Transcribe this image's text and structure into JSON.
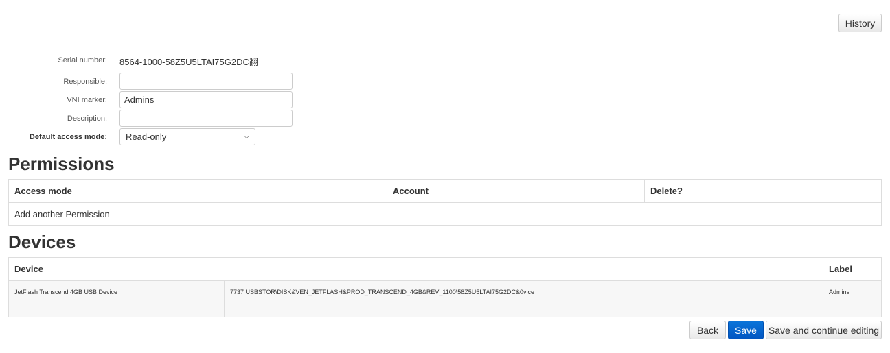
{
  "history_label": "History",
  "form": {
    "serial_label": "Serial number:",
    "serial_value": "8564-1000-58Z5U5LTAI75G2DC翻",
    "responsible_label": "Responsible:",
    "responsible_value": "",
    "vni_label": "VNI marker:",
    "vni_value": "Admins",
    "description_label": "Description:",
    "description_value": "",
    "access_label": "Default access mode:",
    "access_value": "Read-only"
  },
  "permissions": {
    "title": "Permissions",
    "headers": [
      "Access mode",
      "Account",
      "Delete?"
    ],
    "add_label": "Add another Permission"
  },
  "devices": {
    "title": "Devices",
    "headers": [
      "Device",
      "Label"
    ],
    "rows": [
      {
        "name": "JetFlash Transcend 4GB USB Device",
        "id": "7737 USBSTOR\\DISK&VEN_JETFLASH&PROD_TRANSCEND_4GB&REV_1100\\58Z5U5LTAI75G2DC&0vice",
        "label": "Admins"
      }
    ]
  },
  "footer": {
    "back": "Back",
    "save": "Save",
    "save_continue": "Save and continue editing"
  },
  "colors": {
    "primary": "#0563cc"
  }
}
